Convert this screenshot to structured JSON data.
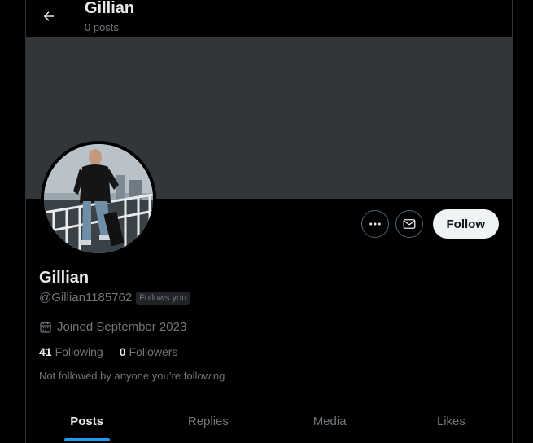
{
  "header": {
    "title": "Gillian",
    "posts_count": "0 posts"
  },
  "profile": {
    "name": "Gillian",
    "handle": "@Gillian1185762",
    "follows_you": "Follows you",
    "joined": "Joined September 2023",
    "following_count": "41",
    "following_label": "Following",
    "followers_count": "0",
    "followers_label": "Followers",
    "not_followed_text": "Not followed by anyone you’re following"
  },
  "actions": {
    "follow_label": "Follow",
    "more_icon": "more-icon",
    "message_icon": "message-icon"
  },
  "tabs": [
    {
      "label": "Posts",
      "active": true
    },
    {
      "label": "Replies",
      "active": false
    },
    {
      "label": "Media",
      "active": false
    },
    {
      "label": "Likes",
      "active": false
    }
  ],
  "colors": {
    "accent": "#1d9bf0",
    "banner": "#333639",
    "background": "#000000",
    "text_primary": "#e7e9ea",
    "text_secondary": "#71767b"
  }
}
